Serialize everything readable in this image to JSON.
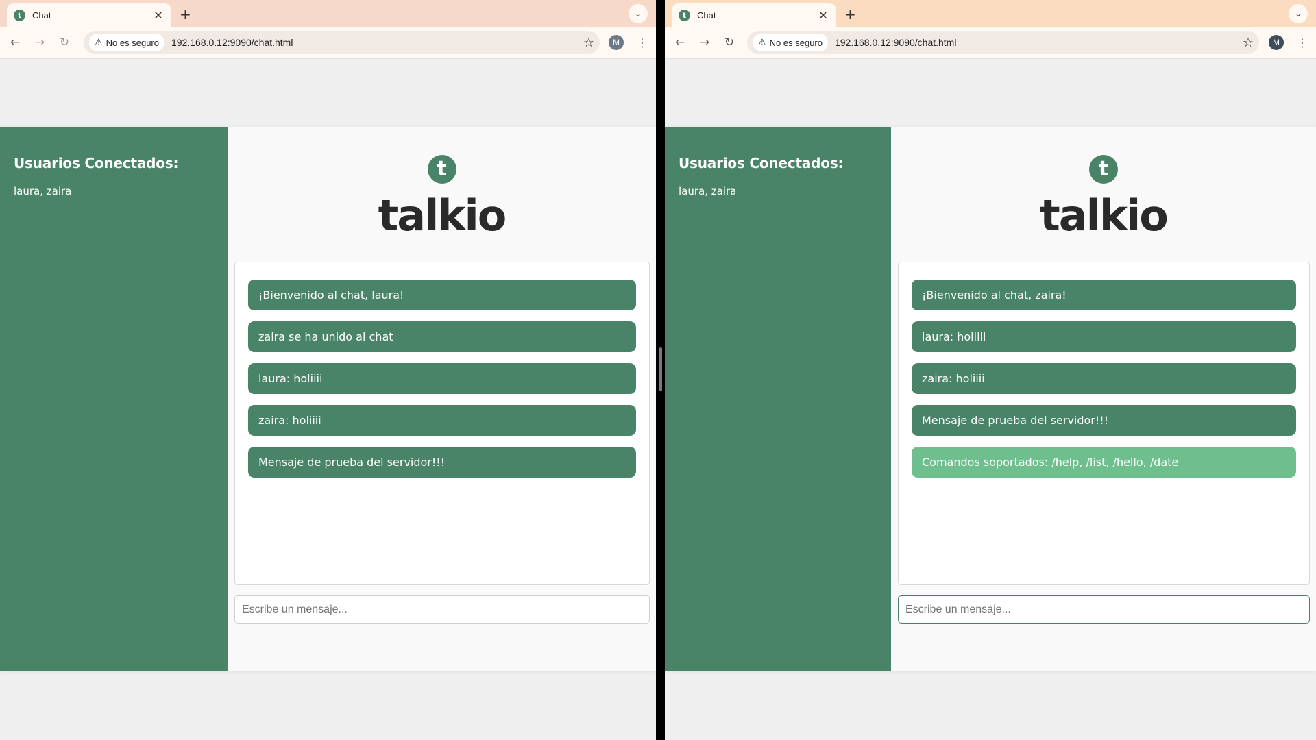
{
  "windows": {
    "left": {
      "tab_title": "Chat",
      "tab_favicon": "t",
      "security_label": "No es seguro",
      "url": "192.168.0.12:9090/chat.html",
      "profile_initial": "M",
      "sidebar_title": "Usuarios Conectados:",
      "sidebar_users": "laura, zaira",
      "logo_letter": "t",
      "logo_word": "talkio",
      "messages": [
        "¡Bienvenido al chat, laura!",
        "zaira se ha unido al chat",
        "laura: holiiii",
        "zaira: holiiii",
        "Mensaje de prueba del servidor!!!"
      ],
      "composer_placeholder": "Escribe un mensaje..."
    },
    "right": {
      "tab_title": "Chat",
      "tab_favicon": "t",
      "security_label": "No es seguro",
      "url": "192.168.0.12:9090/chat.html",
      "profile_initial": "M",
      "sidebar_title": "Usuarios Conectados:",
      "sidebar_users": "laura, zaira",
      "logo_letter": "t",
      "logo_word": "talkio",
      "messages": [
        "¡Bienvenido al chat, zaira!",
        "laura: holiiii",
        "zaira: holiiii",
        "Mensaje de prueba del servidor!!!",
        "Comandos soportados: /help, /list, /hello, /date"
      ],
      "composer_placeholder": "Escribe un mensaje..."
    }
  },
  "icons": {
    "back": "back-arrow-icon",
    "forward": "forward-arrow-icon",
    "reload": "reload-icon",
    "warning": "warning-icon",
    "star": "bookmark-star-icon",
    "menu": "more-vert-icon",
    "close": "close-icon",
    "new_tab": "plus-icon",
    "tab_search": "chevron-down-icon"
  },
  "colors": {
    "brand_green": "#4a8468",
    "system_message_green": "#6fbf8e",
    "logo_text": "#2a2a2a"
  }
}
